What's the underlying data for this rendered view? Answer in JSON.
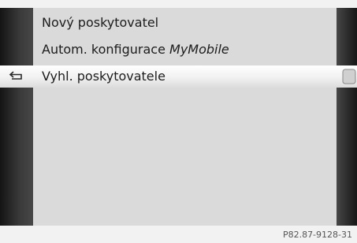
{
  "menu": {
    "items": [
      {
        "label": "Nový poskytovatel"
      },
      {
        "label_prefix": "Autom. konfigurace ",
        "label_emphasis": "MyMobile"
      },
      {
        "label": "Vyhl. poskytovatele",
        "selected": true
      }
    ]
  },
  "icons": {
    "left": "back-arrow-icon",
    "right": "submenu-tab-icon"
  },
  "figure_code": "P82.87-9128-31"
}
